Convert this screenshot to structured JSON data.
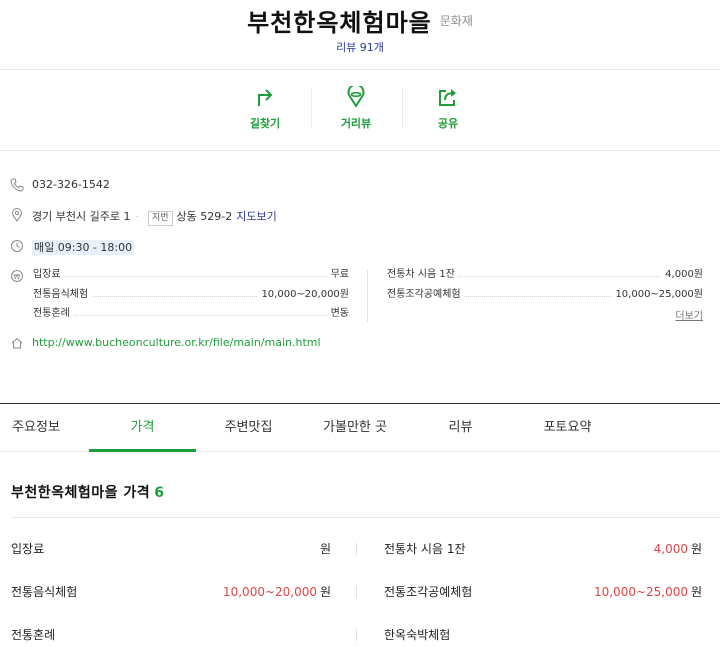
{
  "header": {
    "place_name": "부천한옥체험마을",
    "category": "문화재",
    "review_link": "리뷰 91개"
  },
  "actions": [
    {
      "label": "길찾기",
      "icon": "directions-icon"
    },
    {
      "label": "거리뷰",
      "icon": "street-view-icon"
    },
    {
      "label": "공유",
      "icon": "share-icon"
    }
  ],
  "info": {
    "phone": "032-326-1542",
    "address": "경기 부천시 길주로 1",
    "jibun_tag": "지번",
    "jibun_address": "상동 529-2",
    "map_link": "지도보기",
    "hours": "매일 09:30 - 18:00",
    "website": "http://www.bucheonculture.or.kr/file/main/main.html",
    "more_link": "더보기",
    "prices": [
      {
        "name": "입장료",
        "value": "무료"
      },
      {
        "name": "전통차 시음 1잔",
        "value": "4,000원"
      },
      {
        "name": "전통음식체험",
        "value": "10,000~20,000원"
      },
      {
        "name": "전통조각공예체험",
        "value": "10,000~25,000원"
      },
      {
        "name": "전통혼례",
        "value": "변동"
      }
    ]
  },
  "tabs": [
    {
      "label": "주요정보",
      "active": false
    },
    {
      "label": "가격",
      "active": true
    },
    {
      "label": "주변맛집",
      "active": false
    },
    {
      "label": "가볼만한 곳",
      "active": false
    },
    {
      "label": "리뷰",
      "active": false
    },
    {
      "label": "포토요약",
      "active": false
    }
  ],
  "price_section": {
    "title": "부천한옥체험마을 가격",
    "count": "6",
    "rows": [
      {
        "name": "입장료",
        "value": "",
        "unit": "원"
      },
      {
        "name": "전통차 시음 1잔",
        "value": "4,000",
        "unit": "원"
      },
      {
        "name": "전통음식체험",
        "value": "10,000~20,000",
        "unit": "원"
      },
      {
        "name": "전통조각공예체험",
        "value": "10,000~25,000",
        "unit": "원"
      },
      {
        "name": "전통혼례",
        "value": "",
        "unit": ""
      },
      {
        "name": "한옥숙박체험",
        "value": "",
        "unit": ""
      }
    ]
  },
  "colors": {
    "accent_green": "#1e9e3a",
    "link_blue": "#2d3a9c",
    "price_red": "#e24545"
  }
}
